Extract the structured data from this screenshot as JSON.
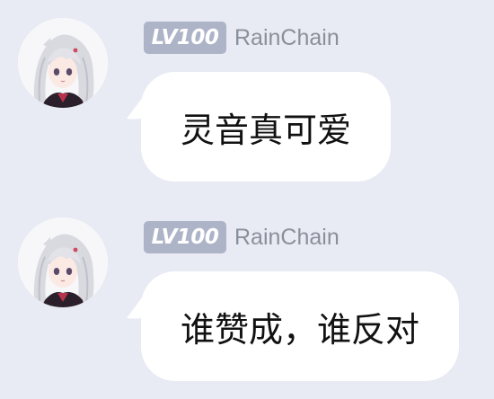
{
  "colors": {
    "background": "#e8ebf3",
    "bubble": "#ffffff",
    "level_badge": "#aeb4c8",
    "username": "#8a8f99",
    "message_text": "#111111"
  },
  "messages": [
    {
      "avatar_icon": "anime-girl-avatar",
      "level": "LV100",
      "username": "RainChain",
      "text": "灵音真可爱"
    },
    {
      "avatar_icon": "anime-girl-avatar",
      "level": "LV100",
      "username": "RainChain",
      "text": "谁赞成，谁反对"
    }
  ]
}
